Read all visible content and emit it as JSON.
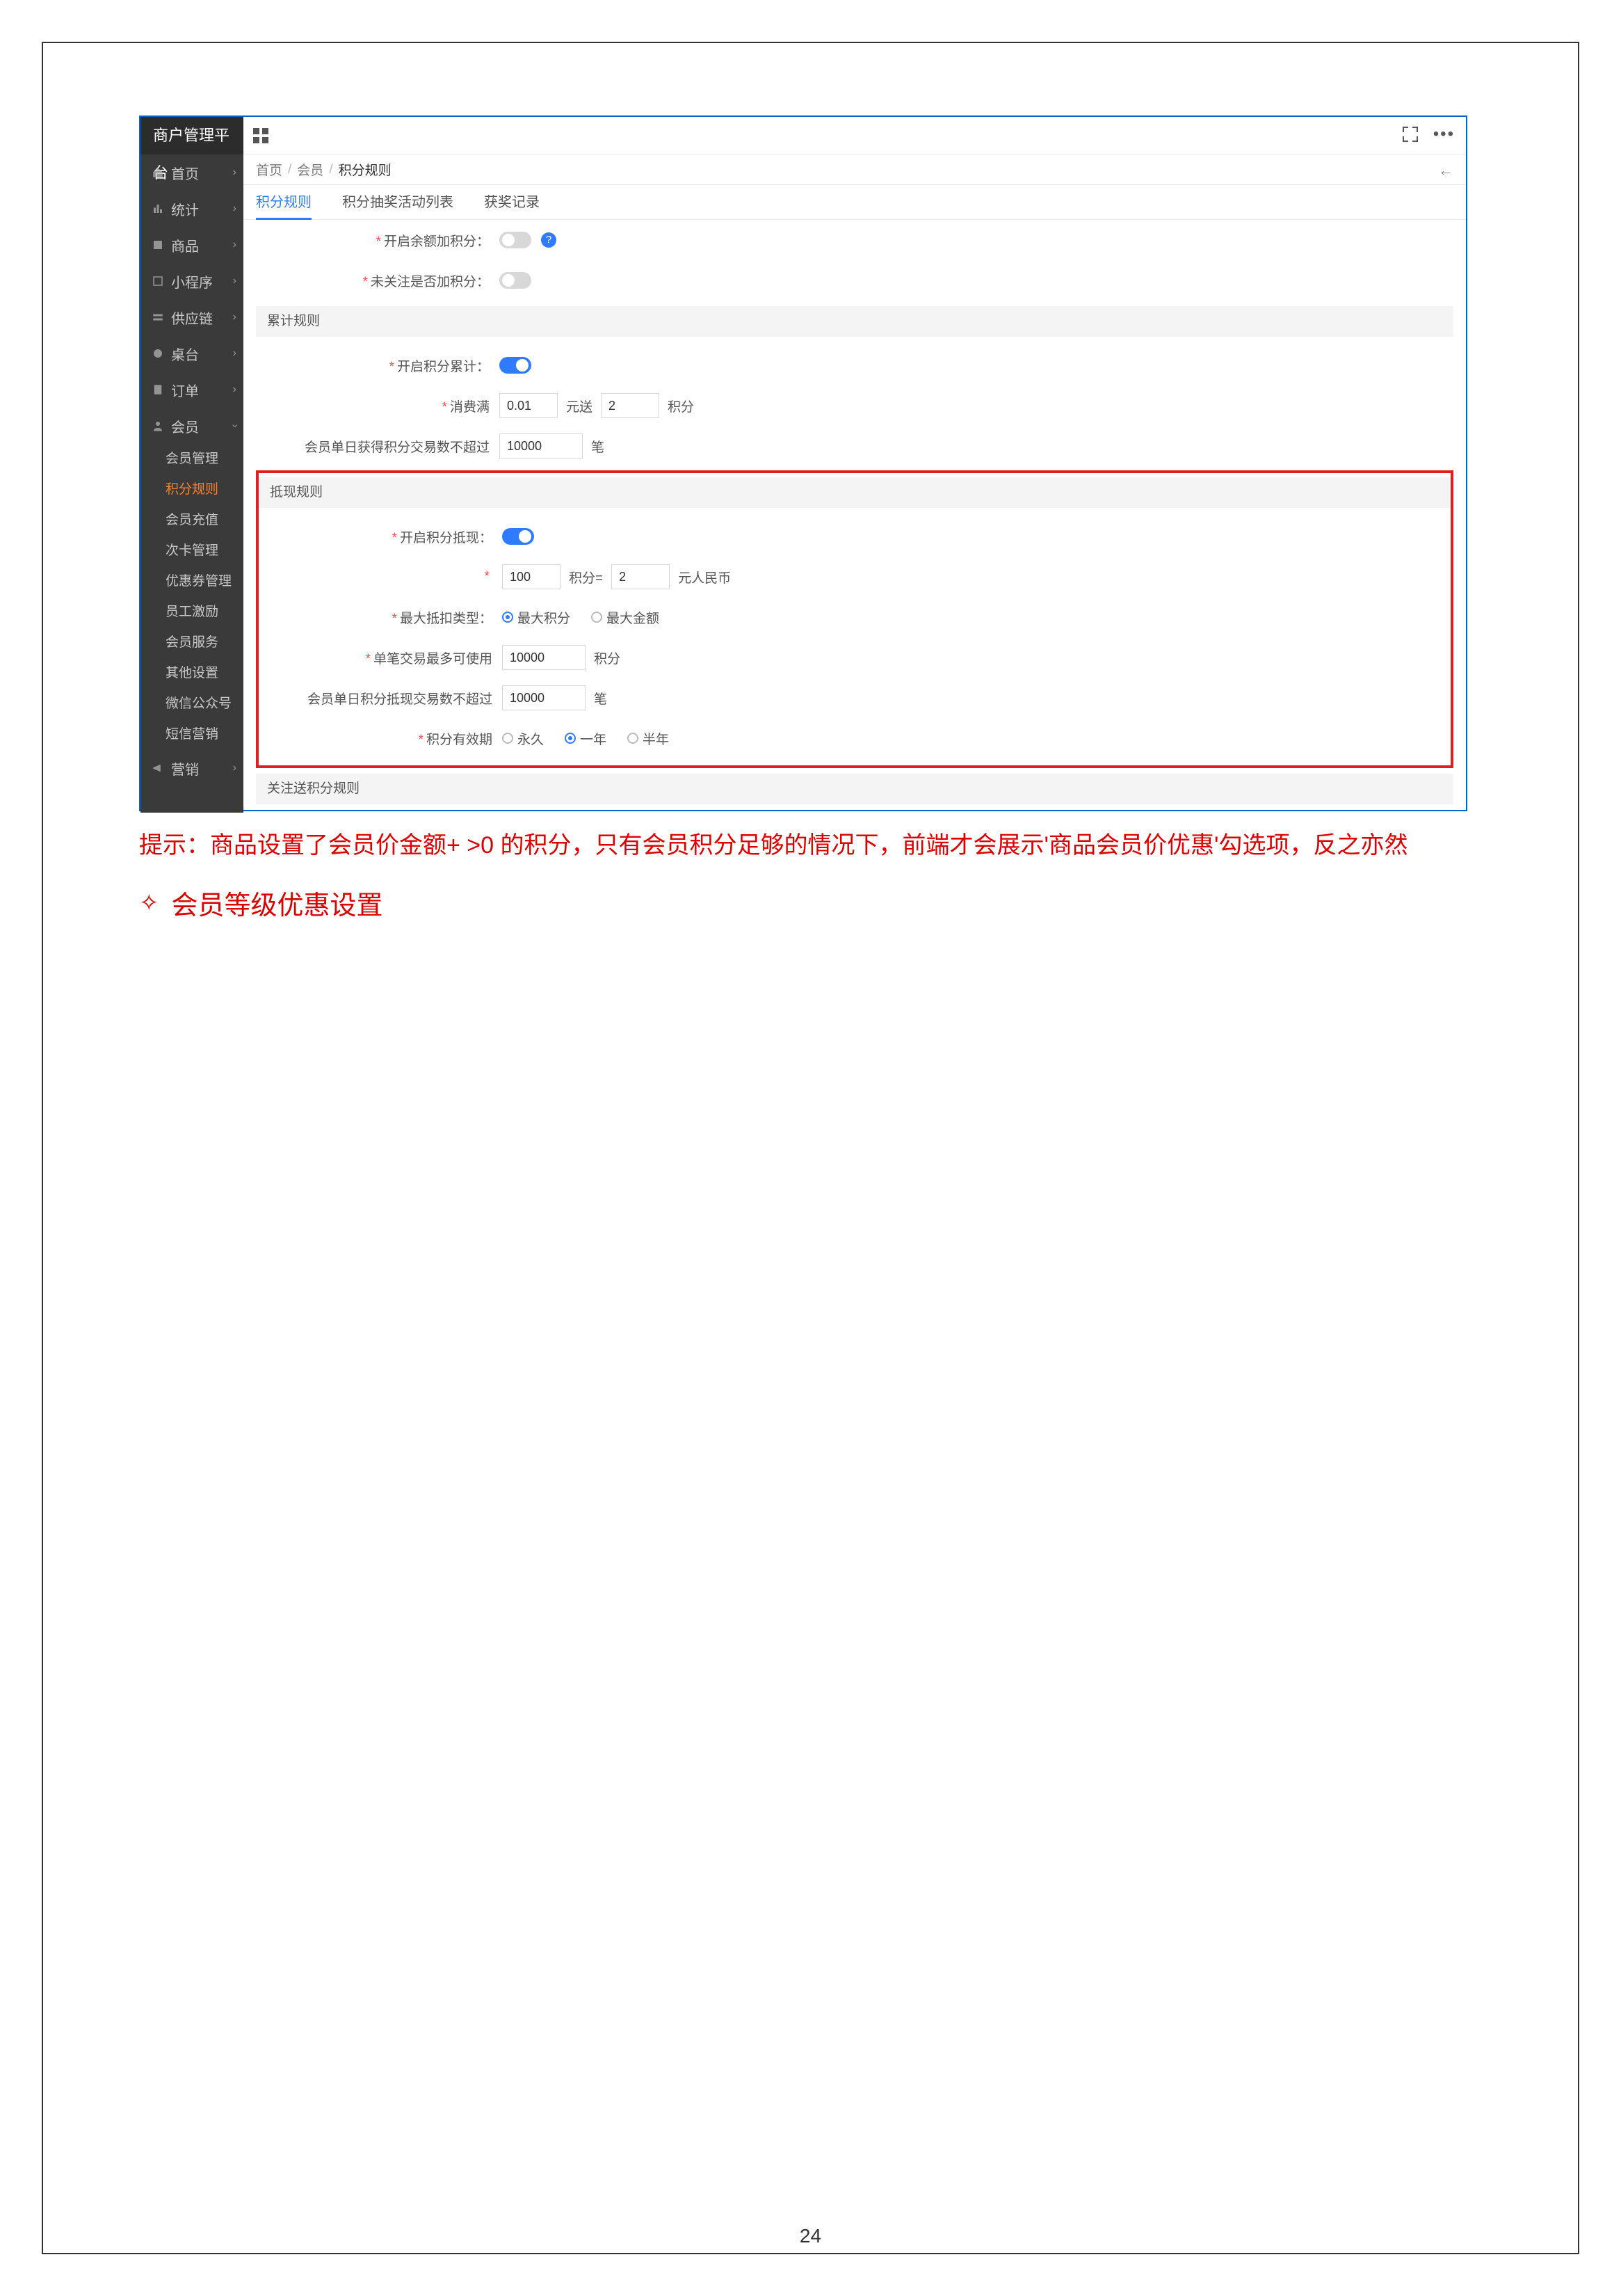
{
  "brand": "商户管理平台",
  "sidebar": {
    "items": [
      {
        "label": "首页",
        "icon": "home"
      },
      {
        "label": "统计",
        "icon": "stats"
      },
      {
        "label": "商品",
        "icon": "goods"
      },
      {
        "label": "小程序",
        "icon": "mini"
      },
      {
        "label": "供应链",
        "icon": "supply"
      },
      {
        "label": "桌台",
        "icon": "table"
      },
      {
        "label": "订单",
        "icon": "order"
      },
      {
        "label": "会员",
        "icon": "member"
      }
    ],
    "subs": [
      {
        "label": "会员管理"
      },
      {
        "label": "积分规则",
        "active": true
      },
      {
        "label": "会员充值"
      },
      {
        "label": "次卡管理"
      },
      {
        "label": "优惠券管理"
      },
      {
        "label": "员工激励"
      },
      {
        "label": "会员服务"
      },
      {
        "label": "其他设置"
      },
      {
        "label": "微信公众号"
      },
      {
        "label": "短信营销"
      }
    ],
    "items2": [
      {
        "label": "营销",
        "icon": "marketing"
      }
    ]
  },
  "breadcrumb": {
    "a": "首页",
    "b": "会员",
    "c": "积分规则"
  },
  "tabs": [
    {
      "label": "积分规则",
      "active": true
    },
    {
      "label": "积分抽奖活动列表"
    },
    {
      "label": "获奖记录"
    }
  ],
  "form": {
    "row_balance_label": "开启余额加积分：",
    "row_unreg_label": "未关注是否加积分：",
    "section_acc": "累计规则",
    "row_acc_label": "开启积分累计：",
    "spend_label": "消费满",
    "spend_amount": "0.01",
    "spend_mid": "元送",
    "spend_points": "2",
    "spend_unit": "积分",
    "daily_gain_label": "会员单日获得积分交易数不超过",
    "daily_gain_val": "10000",
    "daily_gain_unit": "笔",
    "section_deduct": "抵现规则",
    "row_deduct_label": "开启积分抵现：",
    "deduct_points": "100",
    "deduct_mid": "积分=",
    "deduct_rmb": "2",
    "deduct_unit": "元人民币",
    "max_type_label": "最大抵扣类型：",
    "max_type_a": "最大积分",
    "max_type_b": "最大金额",
    "single_tx_label": "单笔交易最多可使用",
    "single_tx_val": "10000",
    "single_tx_unit": "积分",
    "daily_deduct_label": "会员单日积分抵现交易数不超过",
    "daily_deduct_val": "10000",
    "daily_deduct_unit": "笔",
    "valid_label": "积分有效期",
    "valid_a": "永久",
    "valid_b": "一年",
    "valid_c": "半年",
    "section_follow": "关注送积分规则"
  },
  "tip_text": "提示：商品设置了会员价金额+ >0 的积分，只有会员积分足够的情况下，前端才会展示'商品会员价优惠'勾选项，反之亦然",
  "tip_heading": "会员等级优惠设置",
  "page_number": "24"
}
